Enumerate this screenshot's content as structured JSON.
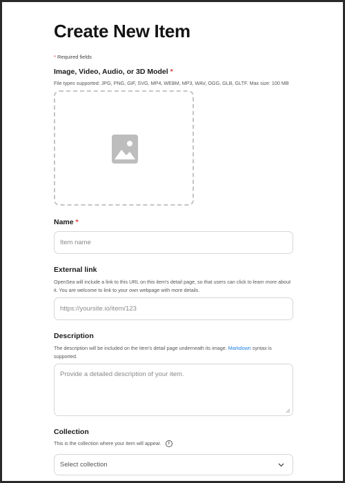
{
  "page": {
    "title": "Create New Item",
    "required_note": "Required fields",
    "required_star": "*"
  },
  "media": {
    "label": "Image, Video, Audio, or 3D Model",
    "file_types": "File types supported: JPG, PNG, GIF, SVG, MP4, WEBM, MP3, WAV, OGG, GLB, GLTF. Max size: 100 MB",
    "icon": "image-placeholder-icon"
  },
  "name": {
    "label": "Name",
    "placeholder": "Item name"
  },
  "external_link": {
    "label": "External link",
    "hint": "OpenSea will include a link to this URL on this item's detail page, so that users can click to learn more about it. You are welcome to link to your own webpage with more details.",
    "placeholder": "https://yoursite.io/item/123"
  },
  "description": {
    "label": "Description",
    "hint_before": "The description will be included on the item's detail page underneath its image.",
    "hint_link": "Markdown",
    "hint_after": "syntax is supported.",
    "placeholder": "Provide a detailed description of your item."
  },
  "collection": {
    "label": "Collection",
    "hint": "This is the collection where your item will appear.",
    "info_icon": "i",
    "select_value": "Select collection"
  },
  "colors": {
    "required": "#d93a3a",
    "link": "#2081e2",
    "border": "#d6d6d6"
  }
}
